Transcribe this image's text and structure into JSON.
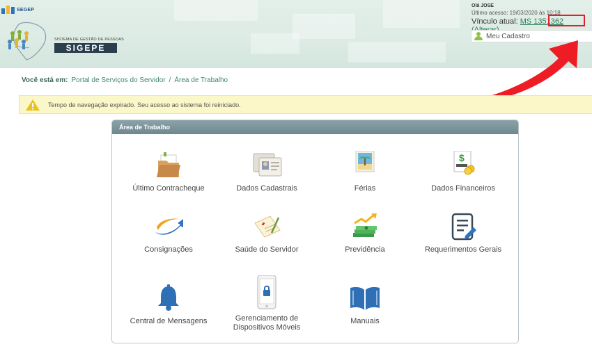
{
  "header": {
    "brand_small": "SEGEP",
    "system_subtitle": "SISTEMA DE GESTÃO DE PESSOAS",
    "system_name": "SIGEPE"
  },
  "user": {
    "greeting": "Olá JOSE",
    "last_access": "Último acesso: 19/03/2020 às 10:18",
    "vinculo_label": "Vínculo atual:",
    "vinculo_value": "MS 1351362",
    "alterar": "(Alterar)",
    "meu_cadastro": "Meu Cadastro"
  },
  "breadcrumb": {
    "label": "Você está em:",
    "items": [
      "Portal de Serviços do Servidor",
      "Área de Trabalho"
    ],
    "separator": "/"
  },
  "alert": {
    "message": "Tempo de navegação expirado. Seu acesso ao sistema foi reiniciado."
  },
  "panel": {
    "title": "Área de Trabalho",
    "tiles": [
      {
        "label": "Último Contracheque",
        "icon": "folder-icon"
      },
      {
        "label": "Dados Cadastrais",
        "icon": "id-cards-icon"
      },
      {
        "label": "Férias",
        "icon": "beach-photo-icon"
      },
      {
        "label": "Dados Financeiros",
        "icon": "money-document-icon"
      },
      {
        "label": "Consignações",
        "icon": "swoosh-arrow-icon"
      },
      {
        "label": "Saúde do Servidor",
        "icon": "medical-form-icon"
      },
      {
        "label": "Previdência",
        "icon": "money-growth-icon"
      },
      {
        "label": "Requerimentos Gerais",
        "icon": "document-edit-icon"
      },
      {
        "label": "Central de Mensagens",
        "icon": "bell-icon"
      },
      {
        "label": "Gerenciamento de Dispositivos Móveis",
        "icon": "mobile-lock-icon"
      },
      {
        "label": "Manuais",
        "icon": "open-book-icon"
      }
    ]
  },
  "colors": {
    "header_bg": "#dcebe4",
    "panel_title_bg": "#7b949a",
    "link_green": "#3b8a6b",
    "alert_bg": "#fbf7c8",
    "highlight_red": "#e0202a",
    "icon_blue": "#2e6fb5"
  }
}
